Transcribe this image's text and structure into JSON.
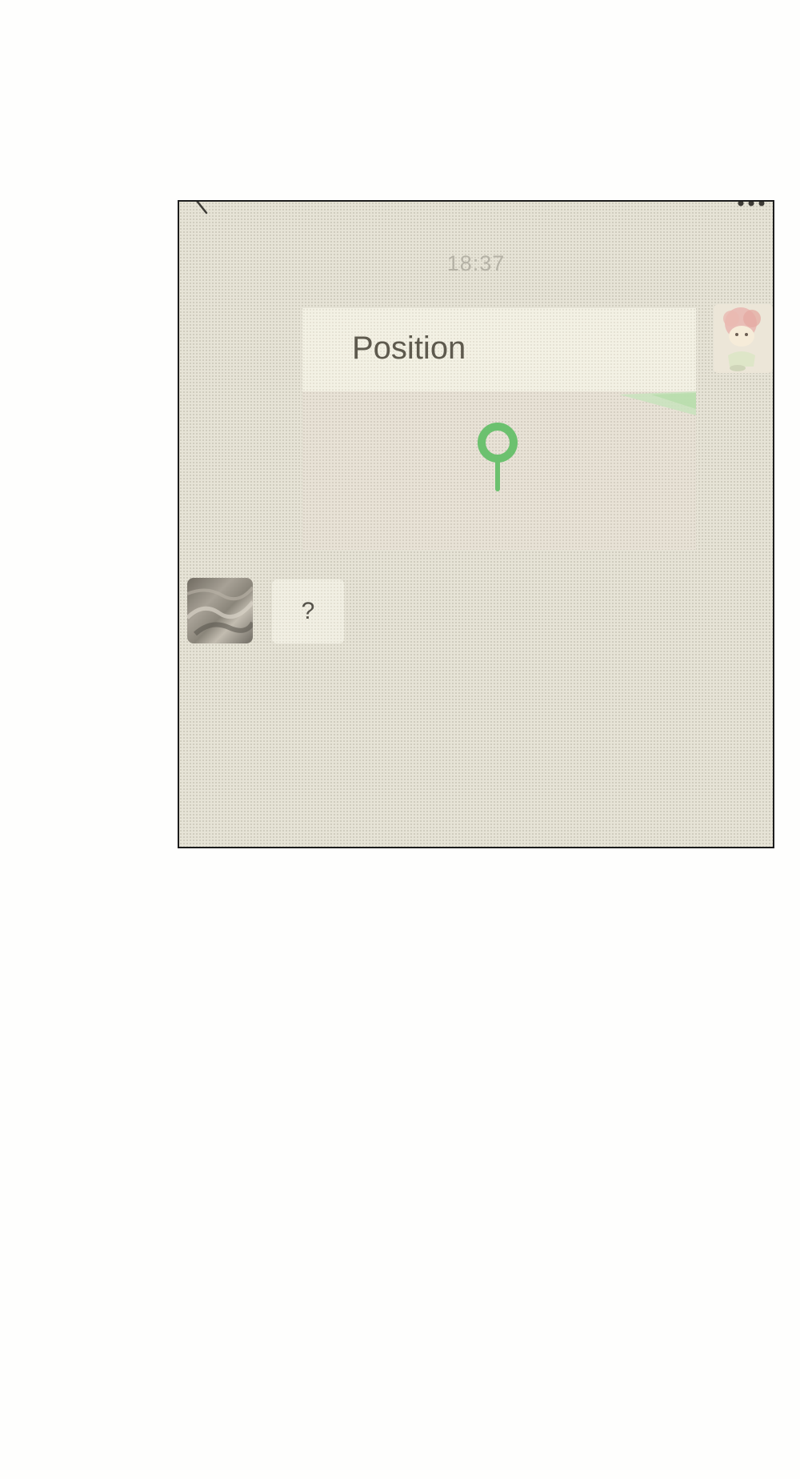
{
  "header": {
    "back_icon": "chevron-left-icon",
    "more_icon": "more-dots-icon"
  },
  "chat": {
    "timestamp": "18:37",
    "messages": [
      {
        "sender": "self",
        "type": "location",
        "title": "Position",
        "icon": "map-pin-icon",
        "pin_color": "#6cc16f"
      },
      {
        "sender": "other",
        "type": "text",
        "text": "?"
      }
    ]
  },
  "colors": {
    "panel_background": "#e6e3d6",
    "bubble_background": "#f3f1e4",
    "accent_green": "#6cc16f",
    "text_dark": "#5e5a4e",
    "timestamp_gray": "#b5b2a6"
  }
}
